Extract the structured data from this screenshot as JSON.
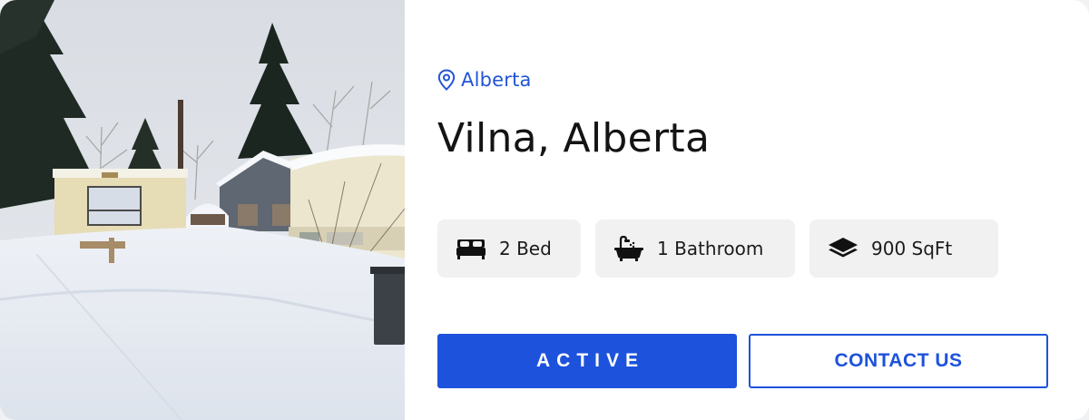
{
  "listing": {
    "location": "Alberta",
    "title": "Vilna, Alberta",
    "features": [
      {
        "icon": "bed-icon",
        "label": "2 Bed"
      },
      {
        "icon": "bathtub-icon",
        "label": "1 Bathroom"
      },
      {
        "icon": "layers-icon",
        "label": "900 SqFt"
      }
    ],
    "status_label": "ACTIVE",
    "contact_label": "CONTACT US"
  },
  "colors": {
    "accent": "#1d52dc",
    "chip_background": "#f1f1f1",
    "title_text": "#141414"
  }
}
